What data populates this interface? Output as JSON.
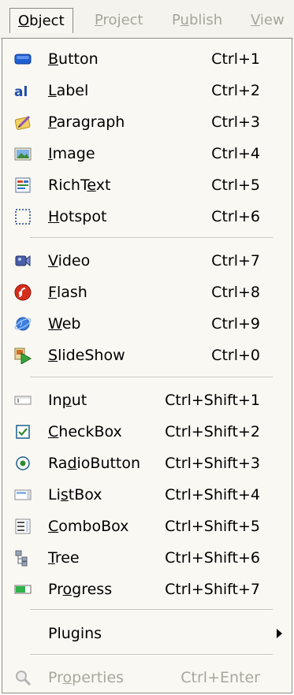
{
  "menubar": {
    "items": [
      {
        "pre": "",
        "u": "O",
        "post": "bject",
        "active": true
      },
      {
        "pre": "",
        "u": "P",
        "post": "roject",
        "active": false
      },
      {
        "pre": "P",
        "u": "u",
        "post": "blish",
        "active": false
      },
      {
        "pre": "",
        "u": "V",
        "post": "iew",
        "active": false
      }
    ]
  },
  "menu": {
    "items": [
      {
        "pre": "",
        "u": "B",
        "post": "utton",
        "shortcut": "Ctrl+1",
        "icon": "button-icon"
      },
      {
        "pre": "",
        "u": "L",
        "post": "abel",
        "shortcut": "Ctrl+2",
        "icon": "label-icon"
      },
      {
        "pre": "",
        "u": "P",
        "post": "aragraph",
        "shortcut": "Ctrl+3",
        "icon": "paragraph-icon"
      },
      {
        "pre": "",
        "u": "I",
        "post": "mage",
        "shortcut": "Ctrl+4",
        "icon": "image-icon"
      },
      {
        "pre": "RichT",
        "u": "e",
        "post": "xt",
        "shortcut": "Ctrl+5",
        "icon": "richtext-icon"
      },
      {
        "pre": "",
        "u": "H",
        "post": "otspot",
        "shortcut": "Ctrl+6",
        "icon": "hotspot-icon"
      },
      {
        "pre": "",
        "u": "V",
        "post": "ideo",
        "shortcut": "Ctrl+7",
        "icon": "video-icon"
      },
      {
        "pre": "",
        "u": "F",
        "post": "lash",
        "shortcut": "Ctrl+8",
        "icon": "flash-icon"
      },
      {
        "pre": "",
        "u": "W",
        "post": "eb",
        "shortcut": "Ctrl+9",
        "icon": "web-icon"
      },
      {
        "pre": "",
        "u": "S",
        "post": "lideShow",
        "shortcut": "Ctrl+0",
        "icon": "slideshow-icon"
      },
      {
        "pre": "In",
        "u": "p",
        "post": "ut",
        "shortcut": "Ctrl+Shift+1",
        "icon": "input-icon"
      },
      {
        "pre": "",
        "u": "C",
        "post": "heckBox",
        "shortcut": "Ctrl+Shift+2",
        "icon": "checkbox-icon"
      },
      {
        "pre": "Ra",
        "u": "d",
        "post": "ioButton",
        "shortcut": "Ctrl+Shift+3",
        "icon": "radiobutton-icon"
      },
      {
        "pre": "Li",
        "u": "s",
        "post": "tBox",
        "shortcut": "Ctrl+Shift+4",
        "icon": "listbox-icon"
      },
      {
        "pre": "",
        "u": "C",
        "post": "omboBox",
        "shortcut": "Ctrl+Shift+5",
        "icon": "combobox-icon"
      },
      {
        "pre": "",
        "u": "T",
        "post": "ree",
        "shortcut": "Ctrl+Shift+6",
        "icon": "tree-icon"
      },
      {
        "pre": "Pr",
        "u": "o",
        "post": "gress",
        "shortcut": "Ctrl+Shift+7",
        "icon": "progress-icon"
      },
      {
        "pre": "Plu",
        "u": "g",
        "post": "ins",
        "shortcut": "",
        "icon": "",
        "submenu": true
      },
      {
        "pre": "Pr",
        "u": "o",
        "post": "perties",
        "shortcut": "Ctrl+Enter",
        "icon": "properties-icon",
        "disabled": true
      }
    ]
  }
}
